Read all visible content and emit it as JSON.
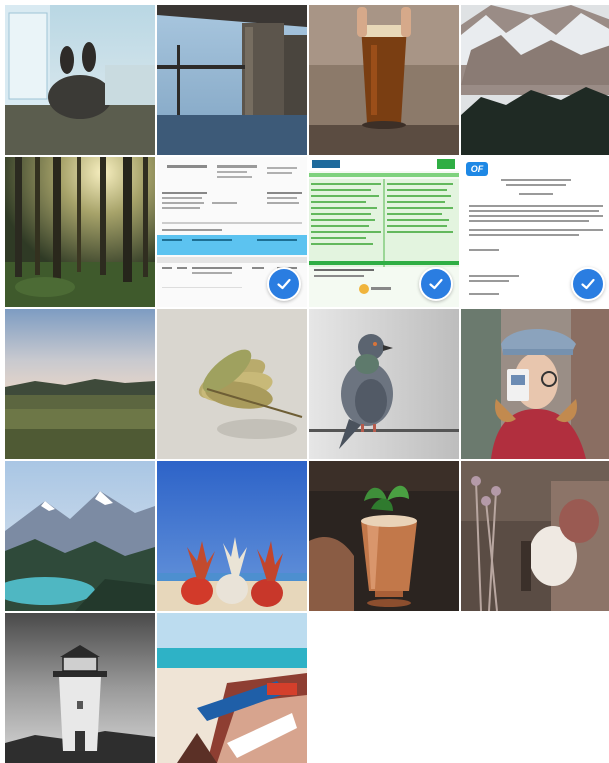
{
  "gallery": {
    "accent_color": "#2a7de1",
    "selected_indices": [
      5,
      6,
      7
    ],
    "photos": [
      {
        "name": "photo-feet-relaxing",
        "selected": false
      },
      {
        "name": "photo-bridge",
        "selected": false
      },
      {
        "name": "photo-beer-glass",
        "selected": false
      },
      {
        "name": "photo-snowy-mountains",
        "selected": false
      },
      {
        "name": "photo-forest-sunlight",
        "selected": false
      },
      {
        "name": "photo-document-invoice",
        "selected": true
      },
      {
        "name": "photo-document-tax-form",
        "selected": true
      },
      {
        "name": "photo-document-letter",
        "selected": true,
        "logo_text": "OF"
      },
      {
        "name": "photo-field-landscape",
        "selected": false
      },
      {
        "name": "photo-dry-leaves",
        "selected": false
      },
      {
        "name": "photo-pigeon",
        "selected": false
      },
      {
        "name": "photo-woman-with-card",
        "selected": false
      },
      {
        "name": "photo-mountain-lake",
        "selected": false
      },
      {
        "name": "photo-pineapples",
        "selected": false
      },
      {
        "name": "photo-copper-cocktail",
        "selected": false
      },
      {
        "name": "photo-dried-flowers",
        "selected": false
      },
      {
        "name": "photo-lighthouse",
        "selected": false
      },
      {
        "name": "photo-beach-boats",
        "selected": false
      }
    ]
  }
}
